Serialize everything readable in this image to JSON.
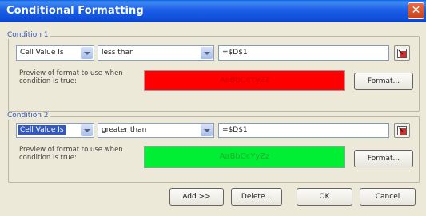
{
  "window": {
    "title": "Conditional Formatting",
    "close_icon": "close-icon"
  },
  "conditions": [
    {
      "label": "Condition 1",
      "type": "Cell Value Is",
      "operator": "less than",
      "formula": "=$D$1",
      "preview_label_line1": "Preview of format to use when",
      "preview_label_line2": "condition is true:",
      "preview_text": "AaBbCcYyZz",
      "preview_bg": "#ff0000",
      "preview_fg": "#cc0000",
      "format_button": "Format..."
    },
    {
      "label": "Condition 2",
      "type": "Cell Value Is",
      "operator": "greater than",
      "formula": "=$D$1",
      "preview_label_line1": "Preview of format to use when",
      "preview_label_line2": "condition is true:",
      "preview_text": "AaBbCcYyZz",
      "preview_bg": "#00ee33",
      "preview_fg": "#22aa33",
      "format_button": "Format..."
    }
  ],
  "buttons": {
    "add": "Add >>",
    "delete": "Delete...",
    "ok": "OK",
    "cancel": "Cancel"
  }
}
